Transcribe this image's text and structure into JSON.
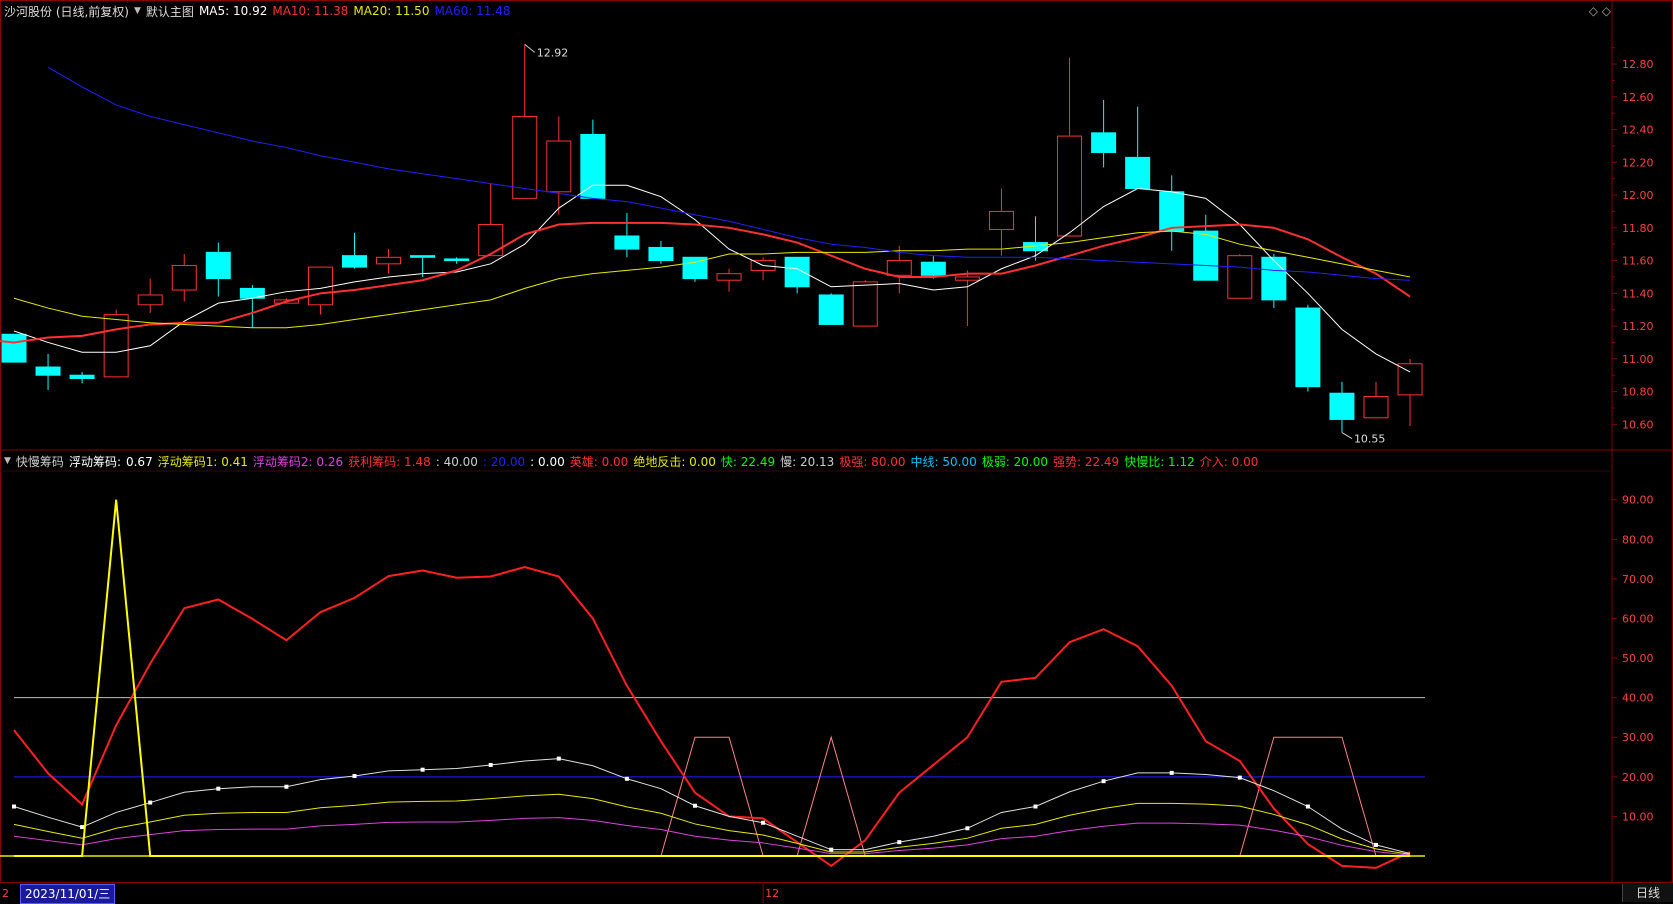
{
  "main_chart": {
    "title": "沙河股份 (日线,前复权)",
    "mode": "默认主图",
    "ma_legend": [
      {
        "name": "MA5",
        "value": "10.92",
        "color": "#ffffff"
      },
      {
        "name": "MA10",
        "value": "11.38",
        "color": "#ff3030"
      },
      {
        "name": "MA20",
        "value": "11.50",
        "color": "#e8e800"
      },
      {
        "name": "MA60",
        "value": "11.48",
        "color": "#2020ff"
      }
    ],
    "high_label": "12.92",
    "low_label": "10.55",
    "y_ticks": [
      "12.80",
      "12.60",
      "12.40",
      "12.20",
      "12.00",
      "11.80",
      "11.60",
      "11.40",
      "11.20",
      "11.00",
      "10.80",
      "10.60"
    ]
  },
  "chart_data": [
    {
      "type": "candlestick",
      "ylim": [
        10.48,
        13.02
      ],
      "up_color": "#ff3030",
      "down_color": "#00ffff",
      "candles": [
        {
          "o": 11.15,
          "c": 10.98,
          "h": 11.15,
          "l": 10.98
        },
        {
          "o": 10.95,
          "c": 10.9,
          "h": 11.03,
          "l": 10.81
        },
        {
          "o": 10.9,
          "c": 10.88,
          "h": 10.92,
          "l": 10.85
        },
        {
          "o": 10.89,
          "c": 11.27,
          "h": 11.3,
          "l": 10.89
        },
        {
          "o": 11.33,
          "c": 11.39,
          "h": 11.49,
          "l": 11.28
        },
        {
          "o": 11.42,
          "c": 11.57,
          "h": 11.64,
          "l": 11.35
        },
        {
          "o": 11.65,
          "c": 11.49,
          "h": 11.71,
          "l": 11.38
        },
        {
          "o": 11.43,
          "c": 11.37,
          "h": 11.45,
          "l": 11.19
        },
        {
          "o": 11.34,
          "c": 11.36,
          "h": 11.37,
          "l": 11.34
        },
        {
          "o": 11.33,
          "c": 11.56,
          "h": 11.56,
          "l": 11.27
        },
        {
          "o": 11.63,
          "c": 11.56,
          "h": 11.77,
          "l": 11.55
        },
        {
          "o": 11.58,
          "c": 11.62,
          "h": 11.67,
          "l": 11.52
        },
        {
          "o": 11.63,
          "c": 11.62,
          "h": 11.63,
          "l": 11.5
        },
        {
          "o": 11.61,
          "c": 11.6,
          "h": 11.62,
          "l": 11.58
        },
        {
          "o": 11.63,
          "c": 11.82,
          "h": 12.07,
          "l": 11.63
        },
        {
          "o": 11.98,
          "c": 12.48,
          "h": 12.92,
          "l": 11.98
        },
        {
          "o": 12.02,
          "c": 12.33,
          "h": 12.48,
          "l": 11.88
        },
        {
          "o": 12.37,
          "c": 11.98,
          "h": 12.46,
          "l": 11.98
        },
        {
          "o": 11.75,
          "c": 11.67,
          "h": 11.89,
          "l": 11.62
        },
        {
          "o": 11.68,
          "c": 11.6,
          "h": 11.72,
          "l": 11.58
        },
        {
          "o": 11.62,
          "c": 11.49,
          "h": 11.62,
          "l": 11.47
        },
        {
          "o": 11.48,
          "c": 11.52,
          "h": 11.55,
          "l": 11.41
        },
        {
          "o": 11.54,
          "c": 11.6,
          "h": 11.62,
          "l": 11.48
        },
        {
          "o": 11.62,
          "c": 11.44,
          "h": 11.62,
          "l": 11.4
        },
        {
          "o": 11.39,
          "c": 11.21,
          "h": 11.4,
          "l": 11.21
        },
        {
          "o": 11.2,
          "c": 11.47,
          "h": 11.48,
          "l": 11.2
        },
        {
          "o": 11.51,
          "c": 11.6,
          "h": 11.69,
          "l": 11.4
        },
        {
          "o": 11.59,
          "c": 11.51,
          "h": 11.63,
          "l": 11.49
        },
        {
          "o": 11.48,
          "c": 11.5,
          "h": 11.54,
          "l": 11.2
        },
        {
          "o": 11.79,
          "c": 11.9,
          "h": 12.04,
          "l": 11.63
        },
        {
          "o": 11.71,
          "c": 11.66,
          "h": 11.87,
          "l": 11.6
        },
        {
          "o": 11.75,
          "c": 12.36,
          "h": 12.84,
          "l": 11.75
        },
        {
          "o": 12.38,
          "c": 12.26,
          "h": 12.58,
          "l": 12.17
        },
        {
          "o": 12.23,
          "c": 12.04,
          "h": 12.54,
          "l": 12.04
        },
        {
          "o": 12.02,
          "c": 11.78,
          "h": 12.12,
          "l": 11.66
        },
        {
          "o": 11.78,
          "c": 11.48,
          "h": 11.88,
          "l": 11.48
        },
        {
          "o": 11.37,
          "c": 11.63,
          "h": 11.64,
          "l": 11.37
        },
        {
          "o": 11.62,
          "c": 11.36,
          "h": 11.64,
          "l": 11.31
        },
        {
          "o": 11.31,
          "c": 10.83,
          "h": 11.33,
          "l": 10.8
        },
        {
          "o": 10.79,
          "c": 10.63,
          "h": 10.86,
          "l": 10.55
        },
        {
          "o": 10.64,
          "c": 10.77,
          "h": 10.86,
          "l": 10.64
        },
        {
          "o": 10.78,
          "c": 10.97,
          "h": 11.0,
          "l": 10.59
        }
      ],
      "ma_lines": [
        {
          "name": "MA5",
          "color": "#ffffff",
          "values": [
            11.17,
            11.1,
            11.04,
            11.04,
            11.08,
            11.23,
            11.34,
            11.37,
            11.41,
            11.43,
            11.47,
            11.5,
            11.52,
            11.53,
            11.58,
            11.7,
            11.92,
            12.06,
            12.06,
            11.99,
            11.85,
            11.67,
            11.57,
            11.55,
            11.44,
            11.45,
            11.46,
            11.42,
            11.44,
            11.55,
            11.63,
            11.77,
            11.93,
            12.04,
            12.02,
            11.98,
            11.82,
            11.6,
            11.4,
            11.18,
            11.03,
            10.92
          ]
        },
        {
          "name": "MA10",
          "color": "#ff3030",
          "values": [
            11.14,
            11.12,
            11.1,
            11.13,
            11.14,
            11.18,
            11.21,
            11.22,
            11.22,
            11.28,
            11.35,
            11.4,
            11.42,
            11.45,
            11.48,
            11.54,
            11.64,
            11.76,
            11.82,
            11.83,
            11.83,
            11.83,
            11.82,
            11.8,
            11.76,
            11.71,
            11.63,
            11.55,
            11.5,
            11.5,
            11.52,
            11.52,
            11.57,
            11.63,
            11.69,
            11.74,
            11.8,
            11.81,
            11.82,
            11.8,
            11.73,
            11.62,
            11.52,
            11.38
          ]
        },
        {
          "name": "MA20",
          "color": "#e8e800",
          "values": [
            11.37,
            11.31,
            11.26,
            11.24,
            11.22,
            11.21,
            11.2,
            11.19,
            11.19,
            11.21,
            11.24,
            11.27,
            11.3,
            11.33,
            11.36,
            11.43,
            11.49,
            11.52,
            11.54,
            11.56,
            11.59,
            11.64,
            11.64,
            11.65,
            11.65,
            11.65,
            11.66,
            11.66,
            11.67,
            11.67,
            11.69,
            11.71,
            11.74,
            11.77,
            11.78,
            11.76,
            11.7,
            11.66,
            11.62,
            11.58,
            11.54,
            11.5
          ]
        },
        {
          "name": "MA60",
          "color": "#2020ff",
          "values": [
            12.78,
            12.66,
            12.55,
            12.48,
            12.43,
            12.38,
            12.33,
            12.29,
            12.24,
            12.2,
            12.16,
            12.13,
            12.1,
            12.07,
            12.04,
            12.01,
            11.98,
            11.96,
            11.92,
            11.88,
            11.84,
            11.79,
            11.74,
            11.7,
            11.68,
            11.65,
            11.63,
            11.62,
            11.62,
            11.62,
            11.61,
            11.6,
            11.59,
            11.58,
            11.57,
            11.56,
            11.54,
            11.53,
            11.51,
            11.49,
            11.48
          ]
        }
      ]
    },
    {
      "type": "line",
      "title": "快慢筹码",
      "ylim": [
        0,
        97
      ],
      "y_ticks": [
        "90.00",
        "80.00",
        "70.00",
        "60.00",
        "50.00",
        "40.00",
        "30.00",
        "20.00",
        "10.00"
      ],
      "series": [
        {
          "name": "慢",
          "color": "#ff2020",
          "values": [
            31.8,
            20.9,
            13.0,
            33.0,
            48.6,
            62.6,
            64.8,
            59.9,
            54.5,
            61.6,
            65.2,
            70.7,
            72.1,
            70.3,
            70.6,
            73.0,
            70.6,
            60.0,
            43.0,
            29.0,
            16.0,
            10.0,
            9.5,
            3.5,
            -2.5,
            4.0,
            16.0,
            23.0,
            30.0,
            44.0,
            45.0,
            54.0,
            57.3,
            53.0,
            43.0,
            29.0,
            24.0,
            12.0,
            3.0,
            -2.5,
            -3.0,
            1.0
          ]
        },
        {
          "name": "快",
          "color": "#e0e0e0",
          "values": [
            12.5,
            9.8,
            7.3,
            11.0,
            13.5,
            16.1,
            17.0,
            17.5,
            17.5,
            19.3,
            20.2,
            21.5,
            21.8,
            22.1,
            23.0,
            24.0,
            24.6,
            22.8,
            19.5,
            17.0,
            12.7,
            10.0,
            8.4,
            5.0,
            1.6,
            1.6,
            3.5,
            5.0,
            7.0,
            11.0,
            12.5,
            16.2,
            18.9,
            21.0,
            21.0,
            20.6,
            19.8,
            16.5,
            12.5,
            6.8,
            2.8,
            0.6
          ]
        },
        {
          "name": "浮动筹码1",
          "color": "#e8e800",
          "values": [
            8.0,
            6.2,
            4.5,
            7.0,
            8.6,
            10.3,
            10.8,
            11.0,
            11.0,
            12.2,
            12.8,
            13.6,
            13.8,
            13.9,
            14.5,
            15.2,
            15.6,
            14.5,
            12.4,
            10.8,
            8.1,
            6.4,
            5.3,
            3.2,
            1.0,
            1.0,
            2.2,
            3.2,
            4.5,
            7.0,
            8.0,
            10.3,
            12.0,
            13.3,
            13.3,
            13.1,
            12.6,
            10.5,
            7.9,
            4.3,
            1.8,
            0.4
          ]
        },
        {
          "name": "浮动筹码2",
          "color": "#e040e0",
          "values": [
            5.0,
            3.9,
            2.8,
            4.4,
            5.4,
            6.4,
            6.7,
            6.8,
            6.8,
            7.6,
            8.0,
            8.5,
            8.6,
            8.6,
            9.0,
            9.5,
            9.7,
            9.0,
            7.7,
            6.7,
            5.0,
            4.0,
            3.3,
            2.0,
            0.6,
            0.6,
            1.4,
            2.0,
            2.8,
            4.4,
            5.0,
            6.4,
            7.5,
            8.3,
            8.3,
            8.1,
            7.8,
            6.5,
            4.9,
            2.7,
            1.1,
            0.2
          ]
        },
        {
          "name": "获利筹码",
          "color": "#ffff00",
          "values": [
            0,
            0,
            0,
            90,
            0,
            0,
            0,
            0,
            0,
            0,
            0,
            0,
            0,
            0,
            0,
            0,
            0,
            0,
            0,
            0,
            0,
            0,
            0,
            0,
            0,
            0,
            0,
            0,
            0,
            0,
            0,
            0,
            0,
            0,
            0,
            0,
            0,
            0,
            0,
            0,
            0,
            0
          ]
        }
      ],
      "trapezoids_color": "#ff8080",
      "ref_lines": [
        {
          "value": 40,
          "color": "#c0c0c0"
        },
        {
          "value": 20,
          "color": "#2020ff"
        }
      ]
    }
  ],
  "sub_chart": {
    "items": [
      {
        "text": "快慢筹码",
        "color": "#cccccc"
      },
      {
        "text": "浮动筹码:",
        "color": "#ffffff"
      },
      {
        "text": "0.67",
        "color": "#ffffff"
      },
      {
        "text": "浮动筹码1: 0.41",
        "color": "#e8e800"
      },
      {
        "text": "浮动筹码2: 0.26",
        "color": "#e040e0"
      },
      {
        "text": "获利筹码: 1.48",
        "color": "#ff3030"
      },
      {
        "text": ": 40.00",
        "color": "#cccccc"
      },
      {
        "text": ": 20.00",
        "color": "#2020ff"
      },
      {
        "text": ": 0.00",
        "color": "#ffffff"
      },
      {
        "text": "英雄: 0.00",
        "color": "#ff3030"
      },
      {
        "text": "绝地反击: 0.00",
        "color": "#e8e800"
      },
      {
        "text": "快: 22.49",
        "color": "#00ff00"
      },
      {
        "text": "慢: 20.13",
        "color": "#cccccc"
      },
      {
        "text": "极强: 80.00",
        "color": "#ff3030"
      },
      {
        "text": "中线: 50.00",
        "color": "#00c0ff"
      },
      {
        "text": "极弱: 20.00",
        "color": "#00ff00"
      },
      {
        "text": "强势: 22.49",
        "color": "#ff3030"
      },
      {
        "text": "快慢比: 1.12",
        "color": "#00ff00"
      },
      {
        "text": "介入: 0.00",
        "color": "#ff3030"
      }
    ]
  },
  "footer": {
    "date": "2023/11/01/三",
    "month_marker": "12",
    "left_marker": "2",
    "daily_button": "日线"
  }
}
